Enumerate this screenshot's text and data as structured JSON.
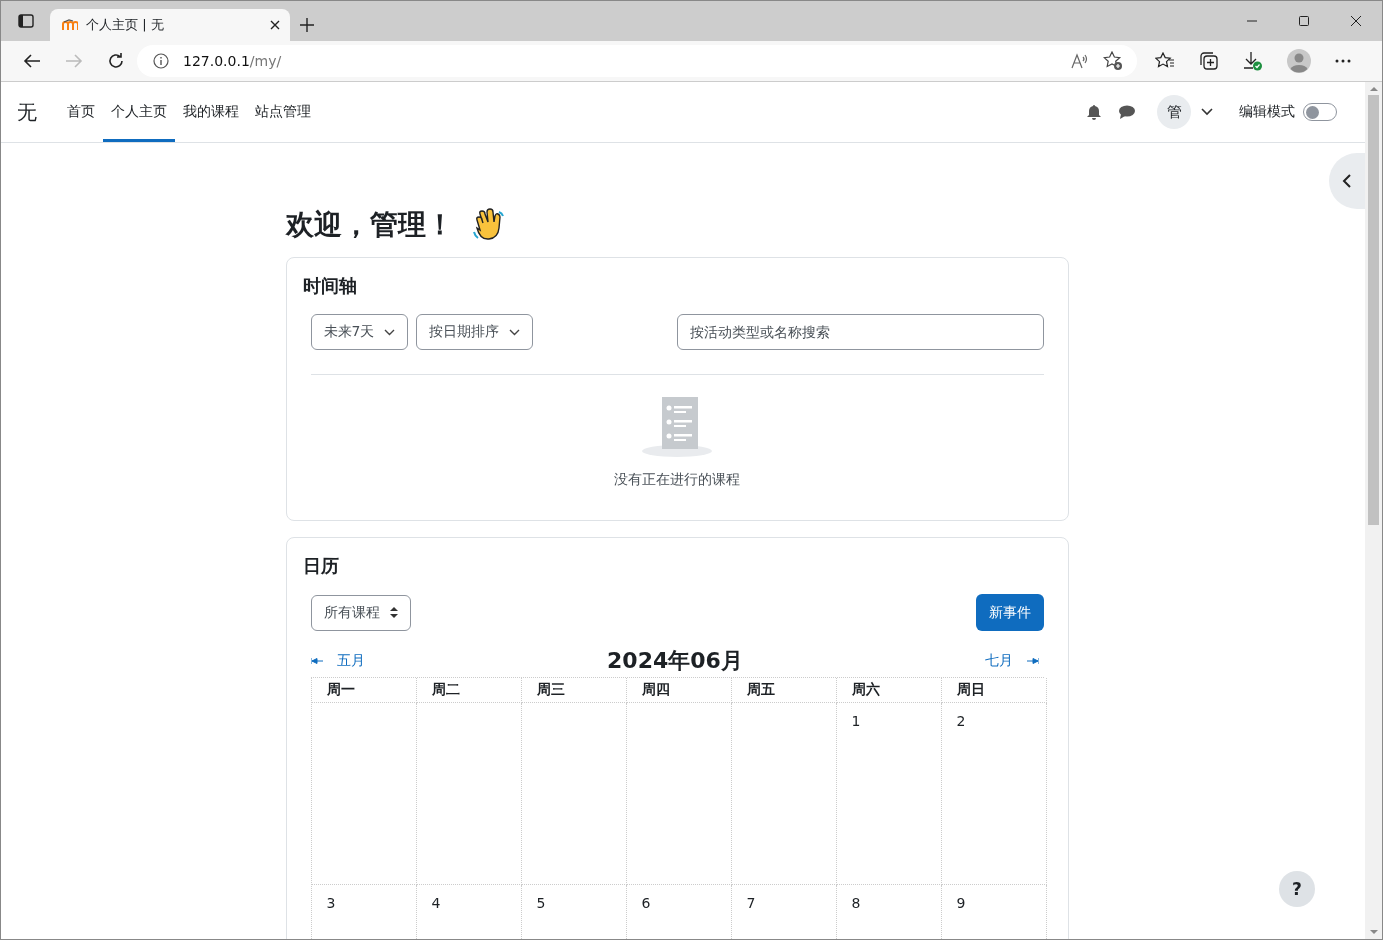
{
  "browser": {
    "tab_title": "个人主页 | 无",
    "url_host": "127.0.0.1",
    "url_path": "/my/"
  },
  "site": {
    "logo": "无",
    "nav": [
      {
        "label": "首页",
        "selected": false
      },
      {
        "label": "个人主页",
        "selected": true
      },
      {
        "label": "我的课程",
        "selected": false
      },
      {
        "label": "站点管理",
        "selected": false
      }
    ],
    "avatar": "管",
    "edit_mode": {
      "label": "编辑模式",
      "on": false
    }
  },
  "welcome": "欢迎，管理！",
  "timeline": {
    "title": "时间轴",
    "filters": [
      "未来7天",
      "按日期排序"
    ],
    "search": {
      "placeholder": "按活动类型或名称搜索"
    },
    "empty_text": "没有正在进行的课程"
  },
  "calendar": {
    "title": "日历",
    "course_select": "所有课程",
    "new_event": "新事件",
    "prev_month": "五月",
    "next_month": "七月",
    "month_title": "2024年06月",
    "weekdays": [
      "周一",
      "周二",
      "周三",
      "周四",
      "周五",
      "周六",
      "周日"
    ],
    "weeks": [
      {
        "kind": "first",
        "days": [
          "1",
          "2"
        ]
      },
      {
        "kind": "full",
        "days": [
          "3",
          "4",
          "5",
          "6",
          "7",
          "8",
          "9"
        ]
      }
    ]
  },
  "help": "?"
}
